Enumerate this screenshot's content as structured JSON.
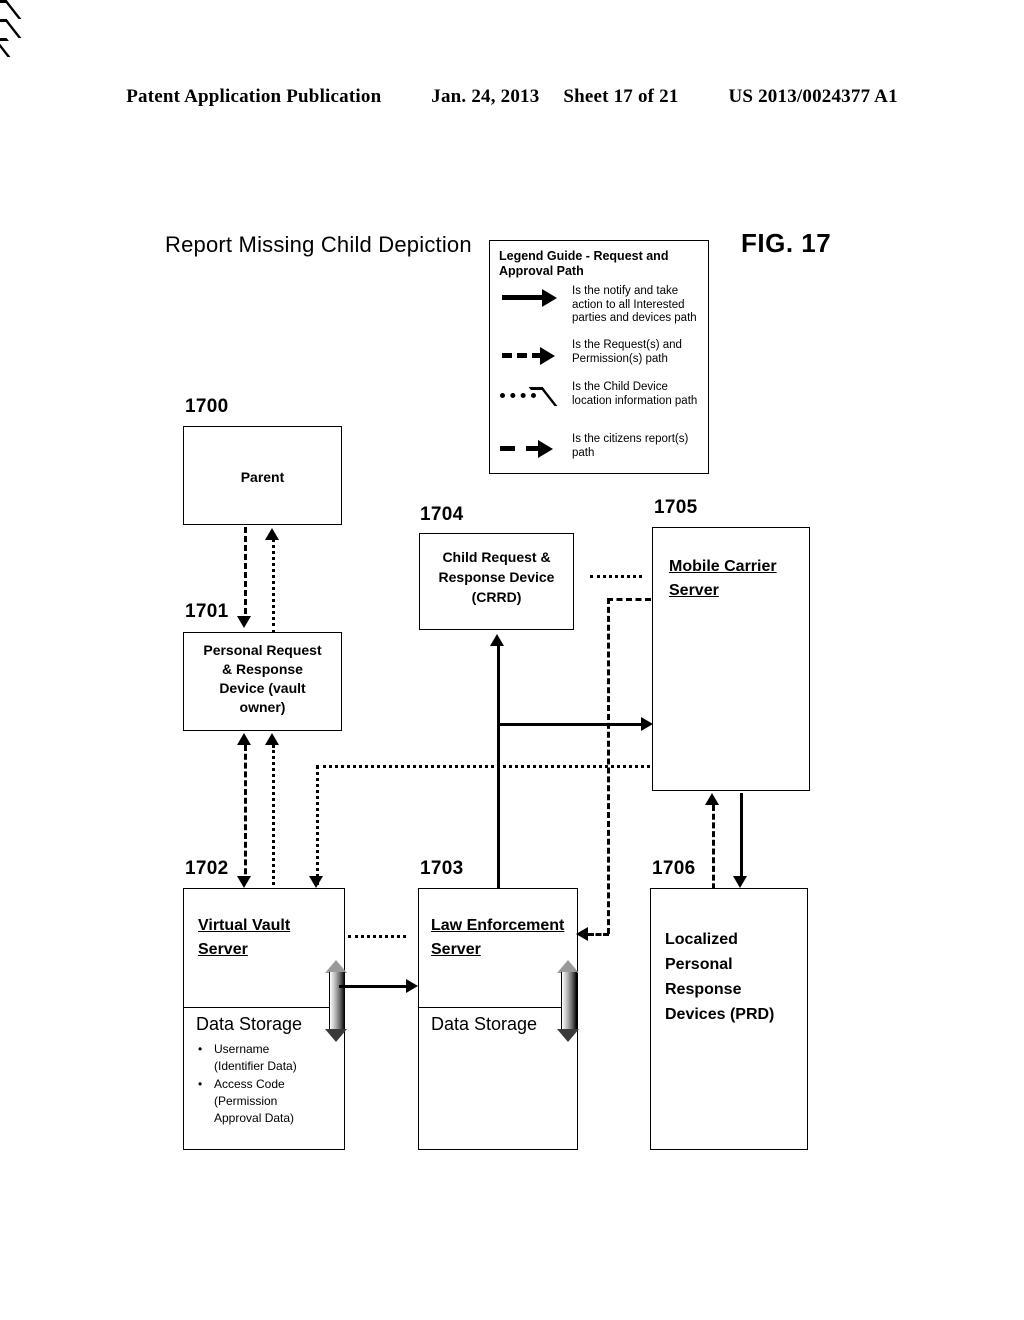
{
  "header": {
    "publication": "Patent Application Publication",
    "date": "Jan. 24, 2013",
    "sheet": "Sheet 17 of 21",
    "number": "US 2013/0024377 A1"
  },
  "figure": {
    "title": "Report Missing Child Depiction",
    "label": "FIG. 17"
  },
  "legend": {
    "title": "Legend Guide -  Request and Approval Path",
    "entries": [
      {
        "style": "solid-arrow",
        "text": "Is the notify and take action to all Interested parties and devices path"
      },
      {
        "style": "dashed-arrow",
        "text": "Is the Request(s) and Permission(s) path"
      },
      {
        "style": "dotted-arrow",
        "text": "Is the Child Device location information path"
      },
      {
        "style": "dash-gap-arrow",
        "text": "Is the citizens report(s) path"
      }
    ]
  },
  "nodes": {
    "parent": {
      "ref": "1700",
      "label": "Parent"
    },
    "prrd": {
      "ref": "1701",
      "line1": "Personal Request",
      "line2": "& Response",
      "line3": "Device (vault",
      "line4": "owner)"
    },
    "vault": {
      "ref": "1702",
      "line1": "Virtual Vault",
      "line2": "Server",
      "storage_title": "Data Storage",
      "storage_items": [
        "Username (Identifier Data)",
        "Access Code (Permission Approval Data)"
      ],
      "storage_items_wrapped": [
        [
          "Username",
          "(Identifier Data)"
        ],
        [
          "Access Code",
          "(Permission",
          "Approval Data)"
        ]
      ]
    },
    "law": {
      "ref": "1703",
      "line1": "Law Enforcement",
      "line2": "Server",
      "storage_title": "Data Storage"
    },
    "crrd": {
      "ref": "1704",
      "line1": "Child Request &",
      "line2": "Response Device",
      "line3": "(CRRD)"
    },
    "carrier": {
      "ref": "1705",
      "line1": "Mobile Carrier",
      "line2": "Server"
    },
    "prd": {
      "ref": "1706",
      "line1": "Localized",
      "line2": "Personal",
      "line3": "Response",
      "line4": "Devices (PRD)"
    }
  }
}
